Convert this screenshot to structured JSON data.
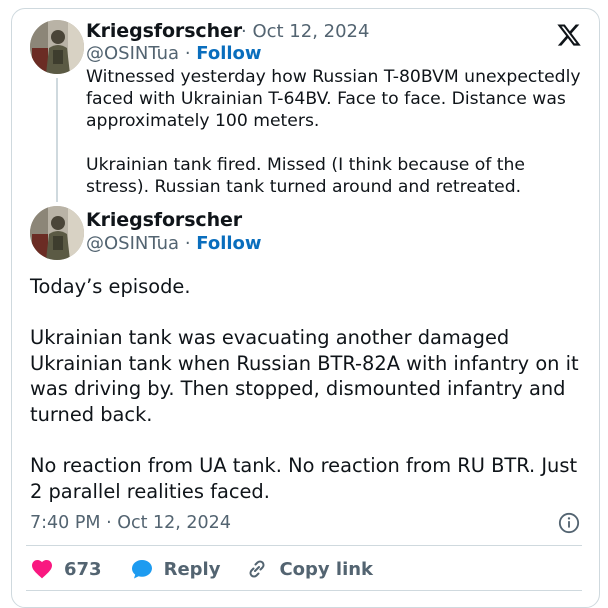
{
  "header": {
    "logo_icon": "x-logo-icon"
  },
  "quoted_tweet": {
    "author_name": "Kriegsforscher",
    "date": "Oct 12, 2024",
    "handle": "@OSINTua",
    "follow_label": "Follow",
    "paragraphs": [
      "Witnessed yesterday how Russian T-80BVM unexpectedly faced with Ukrainian T-64BV.  Face to face. Distance was approximately 100 meters.",
      "Ukrainian tank fired. Missed (I think because of the stress). Russian tank turned around and retreated."
    ]
  },
  "main_tweet": {
    "author_name": "Kriegsforscher",
    "handle": "@OSINTua",
    "follow_label": "Follow",
    "paragraphs": [
      "Today’s episode.",
      "Ukrainian tank was evacuating another damaged Ukrainian tank when Russian BTR-82A with infantry on it was driving by. Then stopped, dismounted infantry and turned back.",
      "No reaction from UA tank. No reaction from RU BTR. Just 2 parallel realities faced."
    ],
    "timestamp": "7:40 PM · Oct 12, 2024"
  },
  "actions": {
    "like_count": "673",
    "reply_label": "Reply",
    "copy_link_label": "Copy link"
  },
  "colors": {
    "like": "#f91880",
    "reply": "#1d9bf0",
    "follow": "#0a6ebd",
    "secondary_text": "#536471",
    "border": "#cfd9de"
  }
}
